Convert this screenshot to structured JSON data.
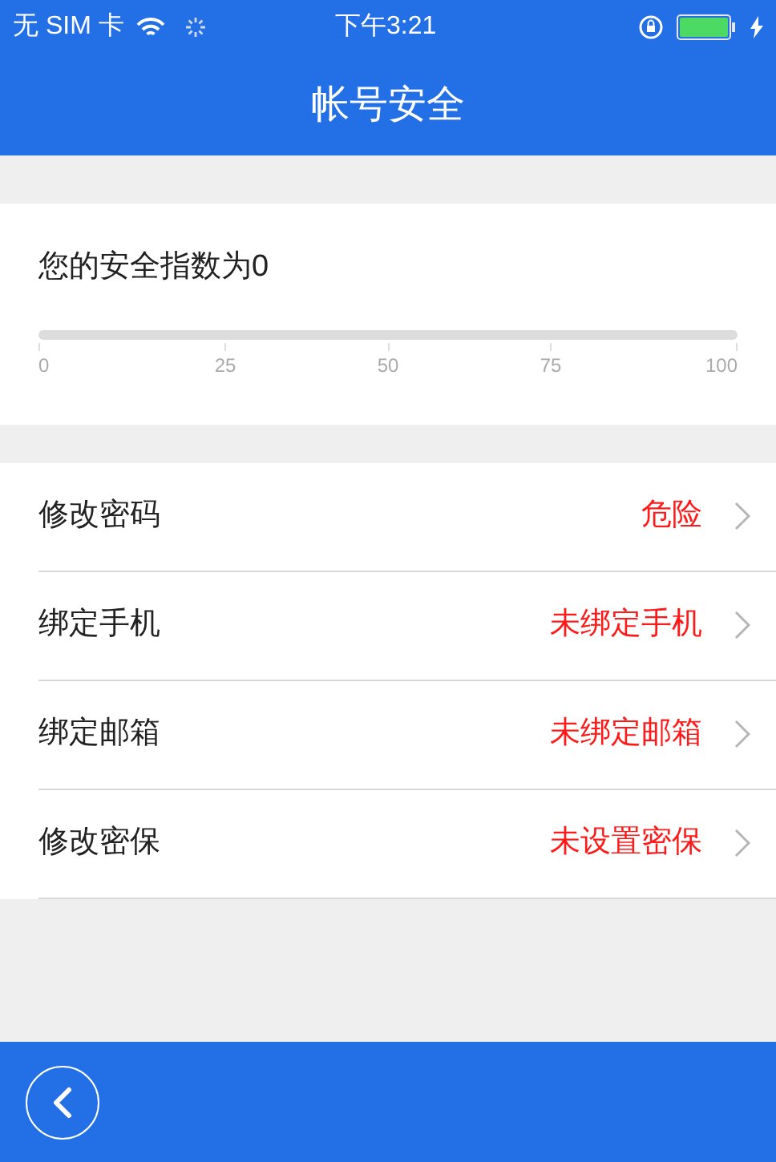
{
  "status_bar": {
    "carrier": "无 SIM 卡",
    "time": "下午3:21"
  },
  "header": {
    "title": "帐号安全"
  },
  "score": {
    "label": "您的安全指数为0",
    "level": 0,
    "ticks": [
      "0",
      "25",
      "50",
      "75",
      "100"
    ]
  },
  "items": [
    {
      "label": "修改密码",
      "status": "危险"
    },
    {
      "label": "绑定手机",
      "status": "未绑定手机"
    },
    {
      "label": "绑定邮箱",
      "status": "未绑定邮箱"
    },
    {
      "label": "修改密保",
      "status": "未设置密保"
    }
  ]
}
